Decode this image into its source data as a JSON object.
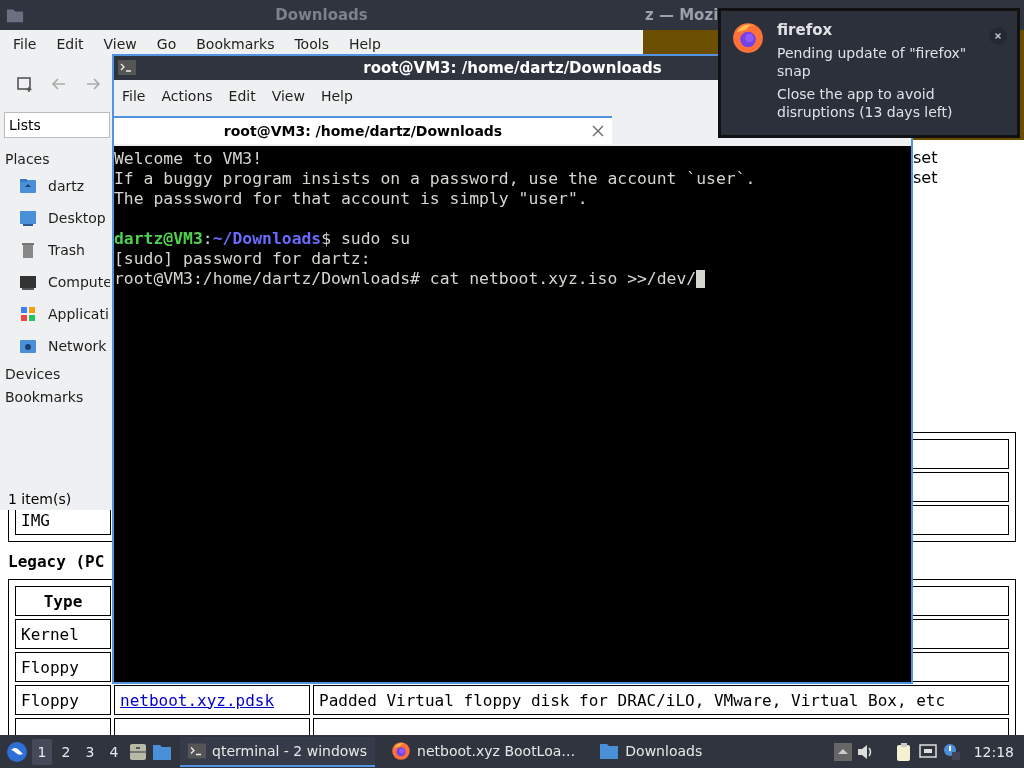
{
  "browser": {
    "title": "z — Mozi",
    "side_text": [
      "set",
      "set"
    ],
    "upper_table": {
      "visible_cell": "IMG"
    },
    "legacy_heading": "Legacy (PC",
    "legacy_table": {
      "header": "Type",
      "rows": [
        {
          "type": "Kernel"
        },
        {
          "type": "Floppy"
        },
        {
          "type": "Floppy",
          "file": "netboot.xyz.pdsk",
          "description": "Padded Virtual floppy disk for DRAC/iLO, VMware, Virtual Box, etc"
        }
      ]
    }
  },
  "file_manager": {
    "title": "Downloads",
    "menu": [
      "File",
      "Edit",
      "View",
      "Go",
      "Bookmarks",
      "Tools",
      "Help"
    ],
    "location": "Lists",
    "sections": [
      {
        "title": "Places",
        "items": [
          {
            "label": "dartz",
            "kind": "home"
          },
          {
            "label": "Desktop",
            "kind": "desktop"
          },
          {
            "label": "Trash",
            "kind": "trash"
          },
          {
            "label": "Compute",
            "kind": "computer"
          },
          {
            "label": "Applicati",
            "kind": "apps"
          },
          {
            "label": "Network",
            "kind": "network"
          }
        ]
      },
      {
        "title": "Devices"
      },
      {
        "title": "Bookmarks"
      }
    ],
    "status": "1 item(s)"
  },
  "terminal": {
    "title": "root@VM3: /home/dartz/Downloads",
    "menu": [
      "File",
      "Actions",
      "Edit",
      "View",
      "Help"
    ],
    "tab": {
      "label": "root@VM3: /home/dartz/Downloads",
      "selected": true
    },
    "lines": [
      {
        "kind": "plain",
        "text": "Welcome to VM3!"
      },
      {
        "kind": "plain",
        "text": "If a buggy program insists on a password, use the account `user`."
      },
      {
        "kind": "plain",
        "text": "The passsword for that account is simply \"user\"."
      },
      {
        "kind": "blank"
      },
      {
        "kind": "prompt",
        "user": "dartz@VM3",
        "sep": ":",
        "path": "~/Downloads",
        "command": "$ sudo su"
      },
      {
        "kind": "plain",
        "text": "[sudo] password for dartz:"
      },
      {
        "kind": "plain",
        "text": "root@VM3:/home/dartz/Downloads# cat netboot.xyz.iso >>/dev/",
        "cursor": true
      }
    ]
  },
  "notification": {
    "app": "firefox",
    "paragraphs": [
      "Pending update of \"firefox\" snap",
      "Close the app to avoid disruptions (13 days left)"
    ]
  },
  "taskbar": {
    "workspaces": [
      {
        "label": "1",
        "selected": true
      },
      {
        "label": "2",
        "selected": false
      },
      {
        "label": "3",
        "selected": false
      },
      {
        "label": "4",
        "selected": false
      }
    ],
    "tasks": [
      {
        "label": "qterminal - 2 windows",
        "kind": "terminal",
        "selected": true
      },
      {
        "label": "netboot.xyz BootLoa…",
        "kind": "firefox",
        "selected": false
      },
      {
        "label": "Downloads",
        "kind": "folder",
        "selected": false
      }
    ],
    "clock": "12:18"
  }
}
